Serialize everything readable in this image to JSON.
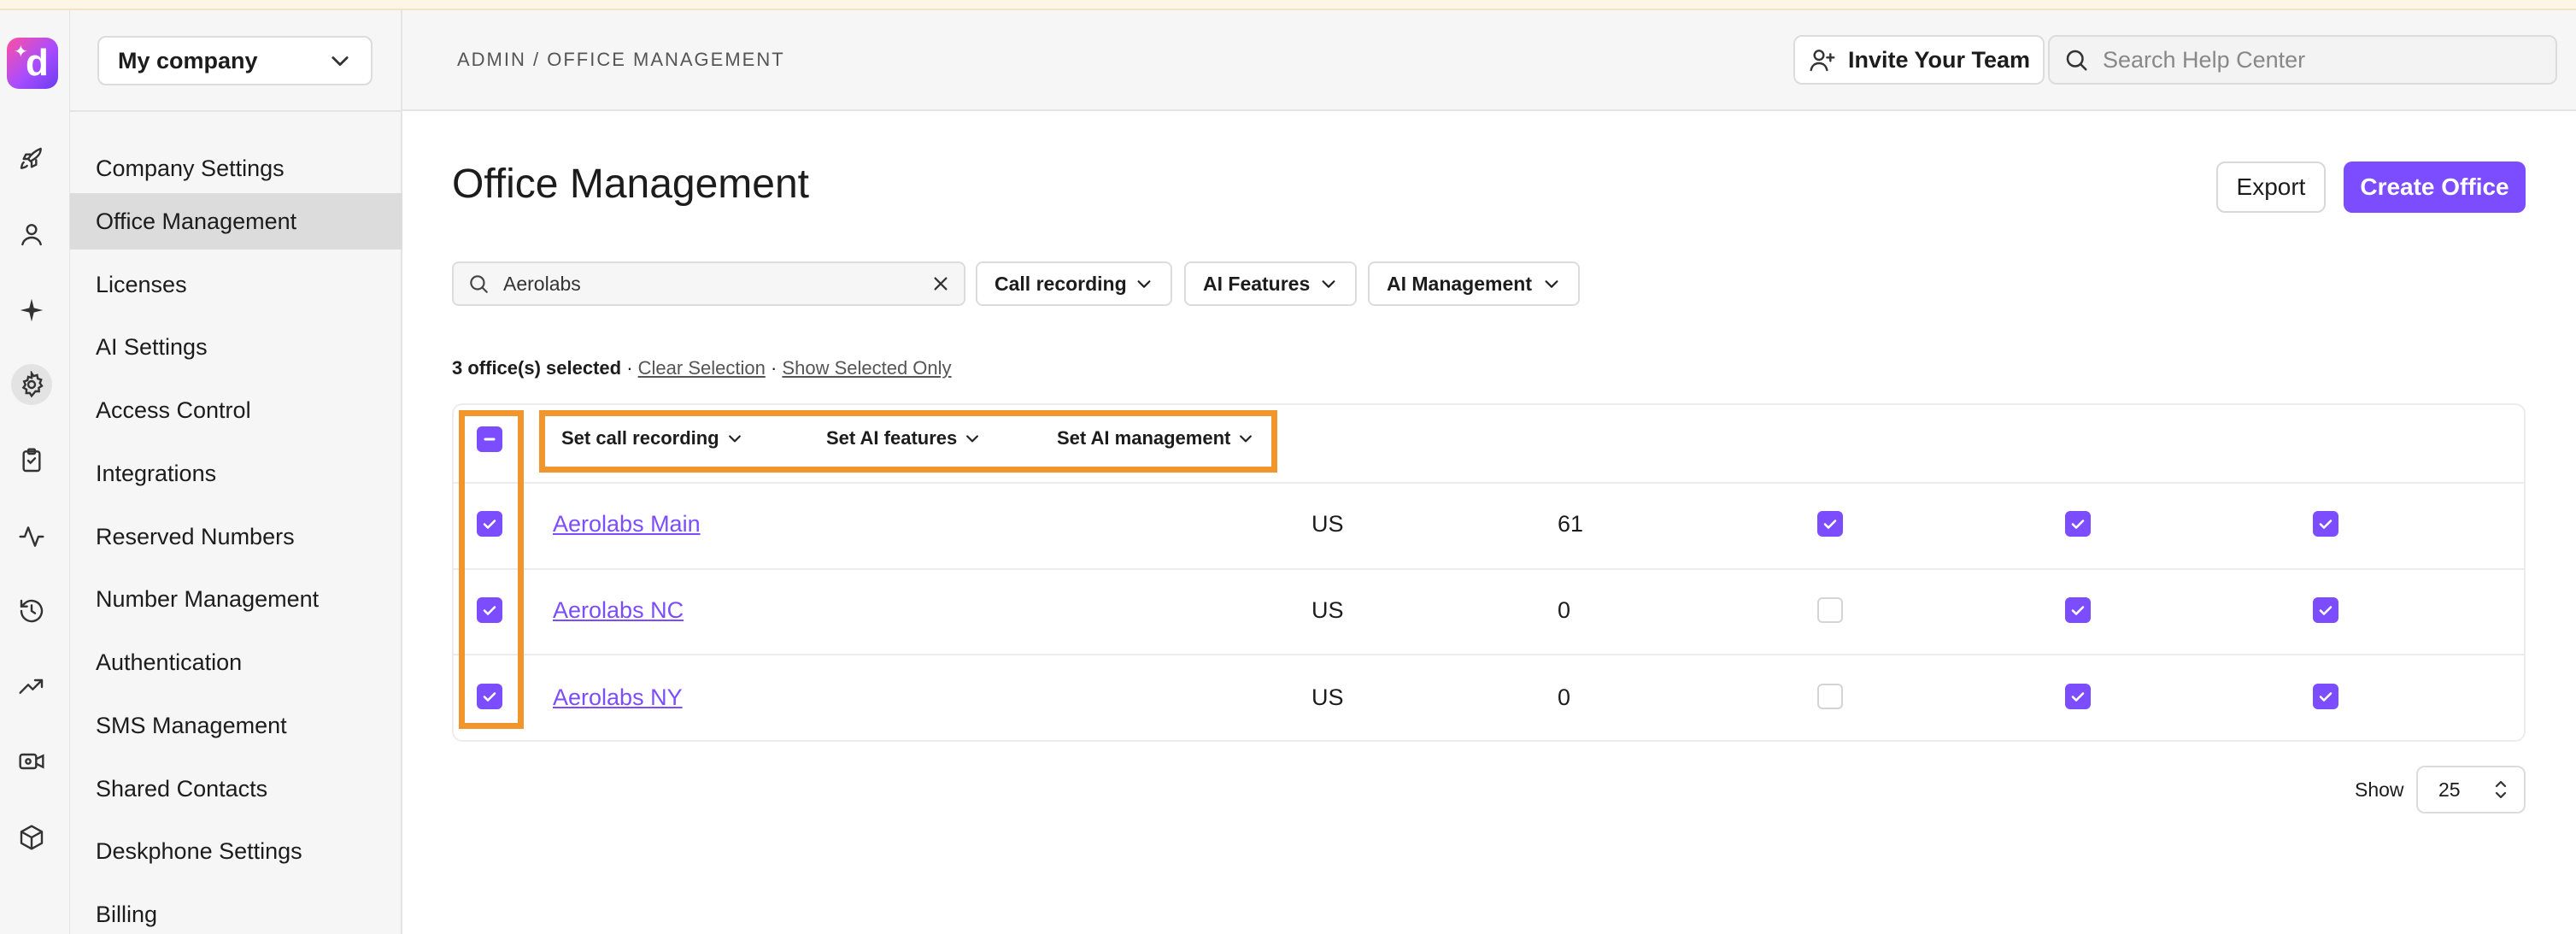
{
  "sidebar": {
    "company": "My company",
    "items": [
      {
        "label": "Company Settings"
      },
      {
        "label": "Office Management"
      },
      {
        "label": "Licenses"
      },
      {
        "label": "AI Settings"
      },
      {
        "label": "Access Control"
      },
      {
        "label": "Integrations"
      },
      {
        "label": "Reserved Numbers"
      },
      {
        "label": "Number Management"
      },
      {
        "label": "Authentication"
      },
      {
        "label": "SMS Management"
      },
      {
        "label": "Shared Contacts"
      },
      {
        "label": "Deskphone Settings"
      },
      {
        "label": "Billing"
      }
    ],
    "active_item": "Office Management"
  },
  "rail": {
    "icons": [
      "rocket-icon",
      "person-icon",
      "sparkle-icon",
      "gear-icon",
      "clipboard-icon",
      "activity-icon",
      "history-icon",
      "trending-icon",
      "video-icon",
      "box-icon"
    ],
    "active": "gear-icon"
  },
  "header": {
    "breadcrumb": "ADMIN / OFFICE MANAGEMENT",
    "invite_label": "Invite Your Team",
    "search_placeholder": "Search Help Center"
  },
  "main": {
    "title": "Office Management",
    "export_label": "Export",
    "create_label": "Create Office",
    "filters": {
      "search_value": "Aerolabs",
      "dropdowns": [
        "Call recording",
        "AI Features",
        "AI Management"
      ]
    },
    "selection": {
      "count_text": "3 office(s) selected",
      "separator": "·",
      "clear": "Clear Selection",
      "show_selected": "Show Selected Only"
    },
    "bulk_actions": [
      "Set call recording",
      "Set AI features",
      "Set AI management"
    ],
    "rows": [
      {
        "name": "Aerolabs Main",
        "country": "US",
        "count": "61",
        "call_recording": true,
        "ai_features": true,
        "ai_management": true
      },
      {
        "name": "Aerolabs NC",
        "country": "US",
        "count": "0",
        "call_recording": false,
        "ai_features": true,
        "ai_management": true
      },
      {
        "name": "Aerolabs NY",
        "country": "US",
        "count": "0",
        "call_recording": false,
        "ai_features": true,
        "ai_management": true
      }
    ],
    "pagination": {
      "show_label": "Show",
      "page_size": "25"
    }
  },
  "colors": {
    "accent": "#7c4dff",
    "highlight": "#f0962d"
  }
}
